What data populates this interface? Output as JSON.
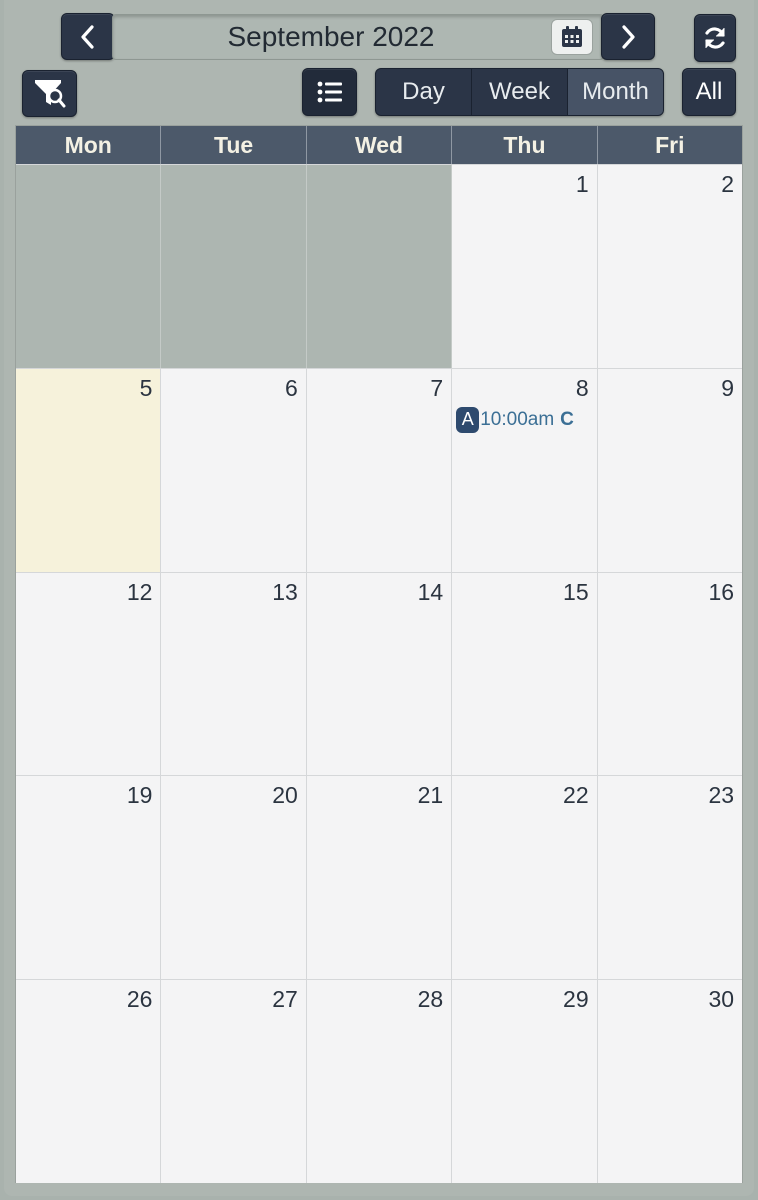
{
  "header": {
    "title": "September 2022"
  },
  "toolbar": {
    "prev_icon": "chevron-left-icon",
    "next_icon": "chevron-right-icon",
    "calendar_icon": "calendar-icon",
    "refresh_icon": "refresh-icon",
    "filter_icon": "filter-search-icon",
    "list_icon": "list-icon",
    "all_label": "All"
  },
  "views": [
    {
      "label": "Day",
      "active": false
    },
    {
      "label": "Week",
      "active": false
    },
    {
      "label": "Month",
      "active": true
    }
  ],
  "weekdays": [
    "Mon",
    "Tue",
    "Wed",
    "Thu",
    "Fri"
  ],
  "weeks": [
    {
      "days": [
        "",
        "",
        "",
        "1",
        "2"
      ]
    },
    {
      "days": [
        "5",
        "6",
        "7",
        "8",
        "9"
      ]
    },
    {
      "days": [
        "12",
        "13",
        "14",
        "15",
        "16"
      ]
    },
    {
      "days": [
        "19",
        "20",
        "21",
        "22",
        "23"
      ]
    },
    {
      "days": [
        "26",
        "27",
        "28",
        "29",
        "30"
      ]
    }
  ],
  "event": {
    "badge": "A",
    "time": "10:00am",
    "title": "C"
  },
  "colors": {
    "button_dark": "#2b3547",
    "header_bg": "#4c596a",
    "today_bg": "#f6f2db",
    "empty_day_bg": "#adb6b1",
    "event_text": "#3b6f95"
  }
}
